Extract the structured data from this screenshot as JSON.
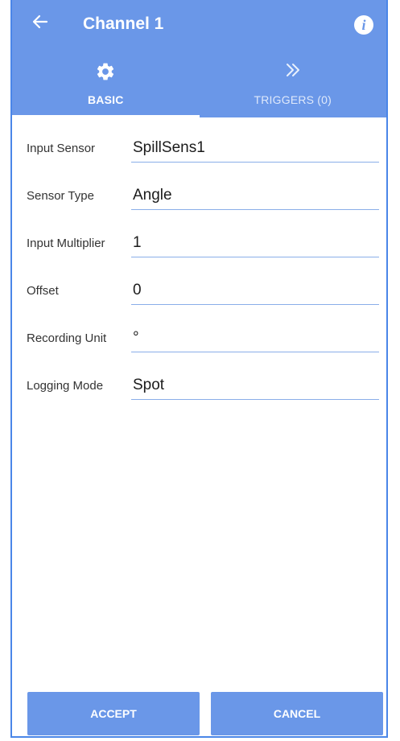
{
  "header": {
    "title": "Channel 1",
    "back_icon": "arrow-left-icon",
    "info_icon": "info-icon",
    "info_glyph": "i",
    "background": "#6a97e8"
  },
  "tabs": [
    {
      "label": "BASIC",
      "icon": "gear-icon",
      "selected": true
    },
    {
      "label": "TRIGGERS (0)",
      "icon": "double-chevron-right-icon",
      "selected": false
    }
  ],
  "form": {
    "fields": [
      {
        "label": "Input Sensor",
        "value": "SpillSens1"
      },
      {
        "label": "Sensor Type",
        "value": "Angle"
      },
      {
        "label": "Input Multiplier",
        "value": "1"
      },
      {
        "label": "Offset",
        "value": "0"
      },
      {
        "label": "Recording Unit",
        "value": "°"
      },
      {
        "label": "Logging Mode",
        "value": "Spot"
      }
    ]
  },
  "actions": {
    "accept_label": "ACCEPT",
    "cancel_label": "CANCEL"
  },
  "colors": {
    "accent": "#6a97e8",
    "border": "#4a86e8",
    "underline": "#8aaee9"
  }
}
